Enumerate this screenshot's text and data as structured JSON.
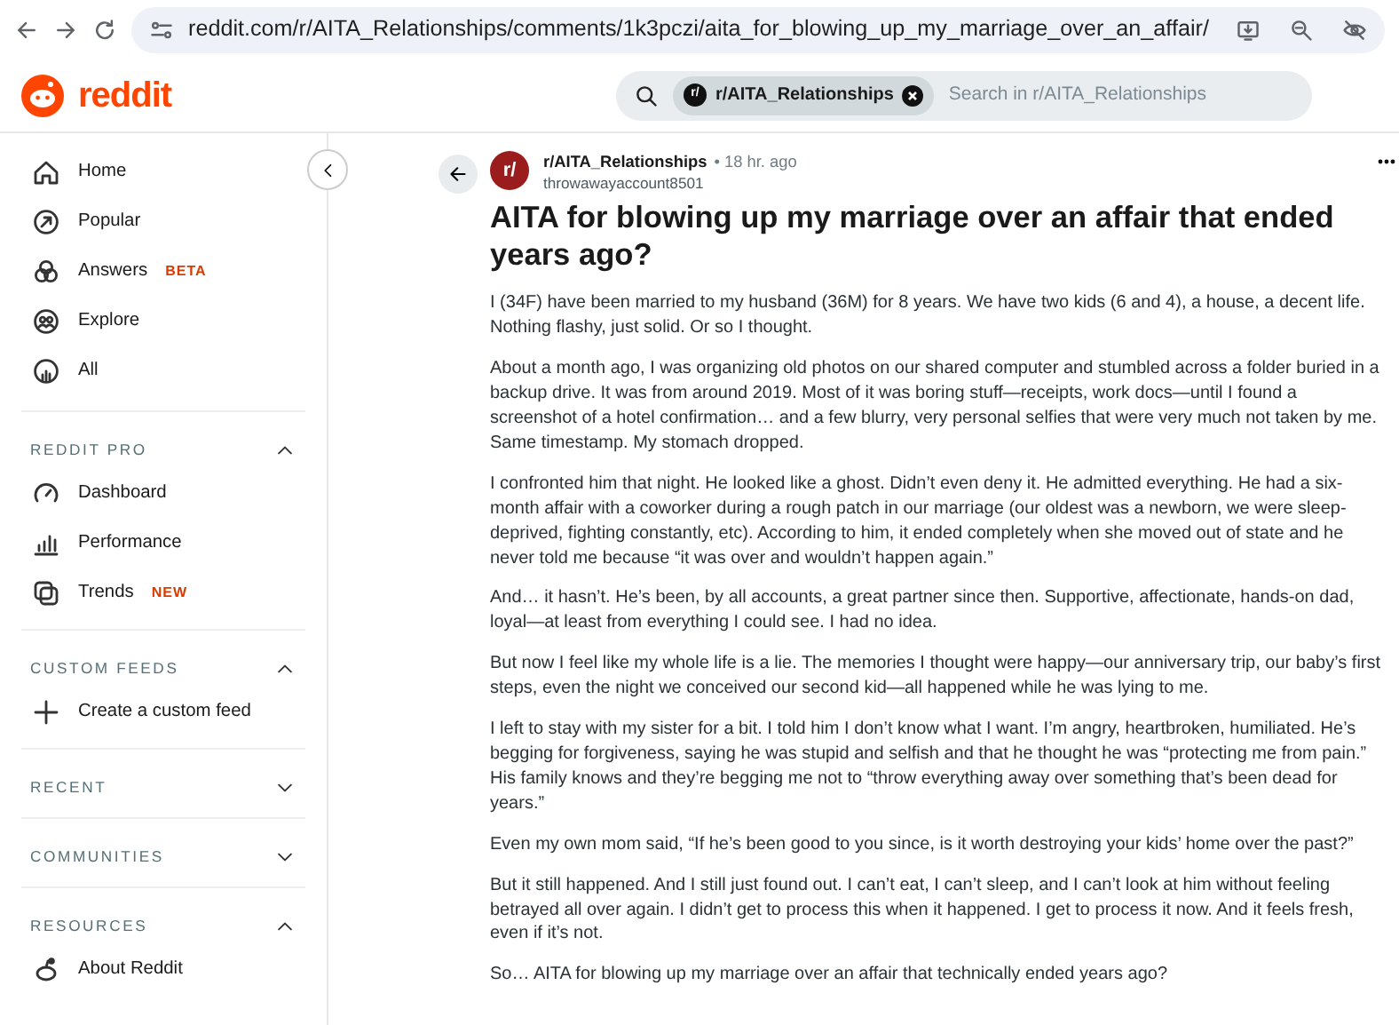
{
  "browser": {
    "url": "reddit.com/r/AITA_Relationships/comments/1k3pczi/aita_for_blowing_up_my_marriage_over_an_affair/"
  },
  "header": {
    "logo_text": "reddit",
    "search": {
      "chip_icon_text": "r/",
      "chip_label": "r/AITA_Relationships",
      "placeholder": "Search in r/AITA_Relationships"
    }
  },
  "sidebar": {
    "items": [
      {
        "label": "Home"
      },
      {
        "label": "Popular"
      },
      {
        "label": "Answers",
        "badge": "BETA"
      },
      {
        "label": "Explore"
      },
      {
        "label": "All"
      }
    ],
    "sections": [
      {
        "title": "REDDIT PRO",
        "expanded": true,
        "items": [
          {
            "label": "Dashboard"
          },
          {
            "label": "Performance"
          },
          {
            "label": "Trends",
            "badge": "NEW"
          }
        ]
      },
      {
        "title": "CUSTOM FEEDS",
        "expanded": true,
        "items": [
          {
            "label": "Create a custom feed"
          }
        ]
      },
      {
        "title": "RECENT",
        "expanded": false
      },
      {
        "title": "COMMUNITIES",
        "expanded": false
      },
      {
        "title": "RESOURCES",
        "expanded": true,
        "items": [
          {
            "label": "About Reddit"
          }
        ]
      }
    ]
  },
  "post": {
    "avatar_text": "r/",
    "subreddit": "r/AITA_Relationships",
    "time": "• 18 hr. ago",
    "author": "throwawayaccount8501",
    "title": "AITA for blowing up my marriage over an affair that ended years ago?",
    "paragraphs": [
      "I (34F) have been married to my husband (36M) for 8 years. We have two kids (6 and 4), a house, a decent life. Nothing flashy, just solid. Or so I thought.",
      "About a month ago, I was organizing old photos on our shared computer and stumbled across a folder buried in a backup drive. It was from around 2019. Most of it was boring stuff—receipts, work docs—until I found a screenshot of a hotel confirmation… and a few blurry, very personal selfies that were very much not taken by me. Same timestamp. My stomach dropped.",
      "I confronted him that night. He looked like a ghost. Didn’t even deny it. He admitted everything. He had a six-month affair with a coworker during a rough patch in our marriage (our oldest was a newborn, we were sleep-deprived, fighting constantly, etc). According to him, it ended completely when she moved out of state and he never told me because “it was over and wouldn’t happen again.”",
      "And… it hasn’t. He’s been, by all accounts, a great partner since then. Supportive, affectionate, hands-on dad, loyal—at least from everything I could see. I had no idea.",
      "But now I feel like my whole life is a lie. The memories I thought were happy—our anniversary trip, our baby’s first steps, even the night we conceived our second kid—all happened while he was lying to me.",
      "I left to stay with my sister for a bit. I told him I don’t know what I want. I’m angry, heartbroken, humiliated. He’s begging for forgiveness, saying he was stupid and selfish and that he thought he was “protecting me from pain.” His family knows and they’re begging me not to “throw everything away over something that’s been dead for years.”",
      "Even my own mom said, “If he’s been good to you since, is it worth destroying your kids’ home over the past?”",
      "But it still happened. And I still just found out. I can’t eat, I can’t sleep, and I can’t look at him without feeling betrayed all over again. I didn’t get to process this when it happened. I get to process it now. And it feels fresh, even if it’s not.",
      "So… AITA for blowing up my marriage over an affair that technically ended years ago?"
    ]
  }
}
